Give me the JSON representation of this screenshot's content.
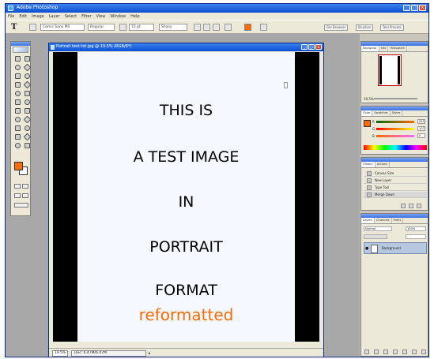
{
  "app": {
    "title": "Adobe Photoshop",
    "window_buttons": [
      "_",
      "□",
      "×"
    ]
  },
  "menu": [
    "File",
    "Edit",
    "Image",
    "Layer",
    "Select",
    "Filter",
    "View",
    "Window",
    "Help"
  ],
  "options_bar": {
    "tool_icon": "type-tool-icon",
    "font_family": "Comic Sans MS",
    "font_style": "Regular",
    "font_size": "72 pt",
    "antialias": "Sharp",
    "text_color": "#ff6a00",
    "palette_tabs": [
      "File Browser",
      "Brushes",
      "Tool Presets"
    ]
  },
  "document": {
    "title": "Portrait test-txt.jpg @ 19.5% (RGB/8*)",
    "zoom": "19.5%",
    "status": "Doc: 6.47M/6.47M",
    "lines": [
      "THIS IS",
      "A TEST IMAGE",
      "IN",
      "PORTRAIT",
      "FORMAT"
    ],
    "highlight_line": "reformatted",
    "highlight_color": "#ff6a00"
  },
  "palettes": {
    "navigator": {
      "tabs": [
        "Navigator",
        "Info",
        "Histogram"
      ],
      "zoom": "19.5%"
    },
    "color": {
      "tabs": [
        "Color",
        "Swatches",
        "Styles"
      ],
      "channels": [
        "R",
        "G",
        "B"
      ],
      "values": [
        "255",
        "107",
        "0"
      ]
    },
    "history": {
      "tabs": [
        "History",
        "Actions"
      ],
      "items": [
        "Canvas Size",
        "New Layer",
        "Type Tool",
        "Merge Down"
      ],
      "selected_index": 3
    },
    "layers": {
      "tabs": [
        "Layers",
        "Channels",
        "Paths"
      ],
      "blend_mode": "Normal",
      "opacity": "100%",
      "layer_name": "Background"
    }
  }
}
